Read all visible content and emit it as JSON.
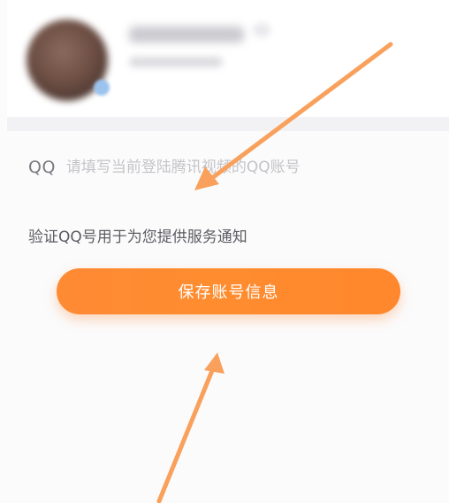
{
  "form": {
    "qq_label": "QQ",
    "qq_placeholder": "请填写当前登陆腾讯视频的QQ账号",
    "hint": "验证QQ号用于为您提供服务通知",
    "save_label": "保存账号信息"
  },
  "colors": {
    "accent": "#ff8a34",
    "annotation_arrow": "#f9a15c",
    "placeholder": "#c4c4c8",
    "hint_text": "#5c5c62"
  },
  "annotations": {
    "arrow_icon_1": "arrow-icon",
    "arrow_icon_2": "arrow-icon"
  }
}
